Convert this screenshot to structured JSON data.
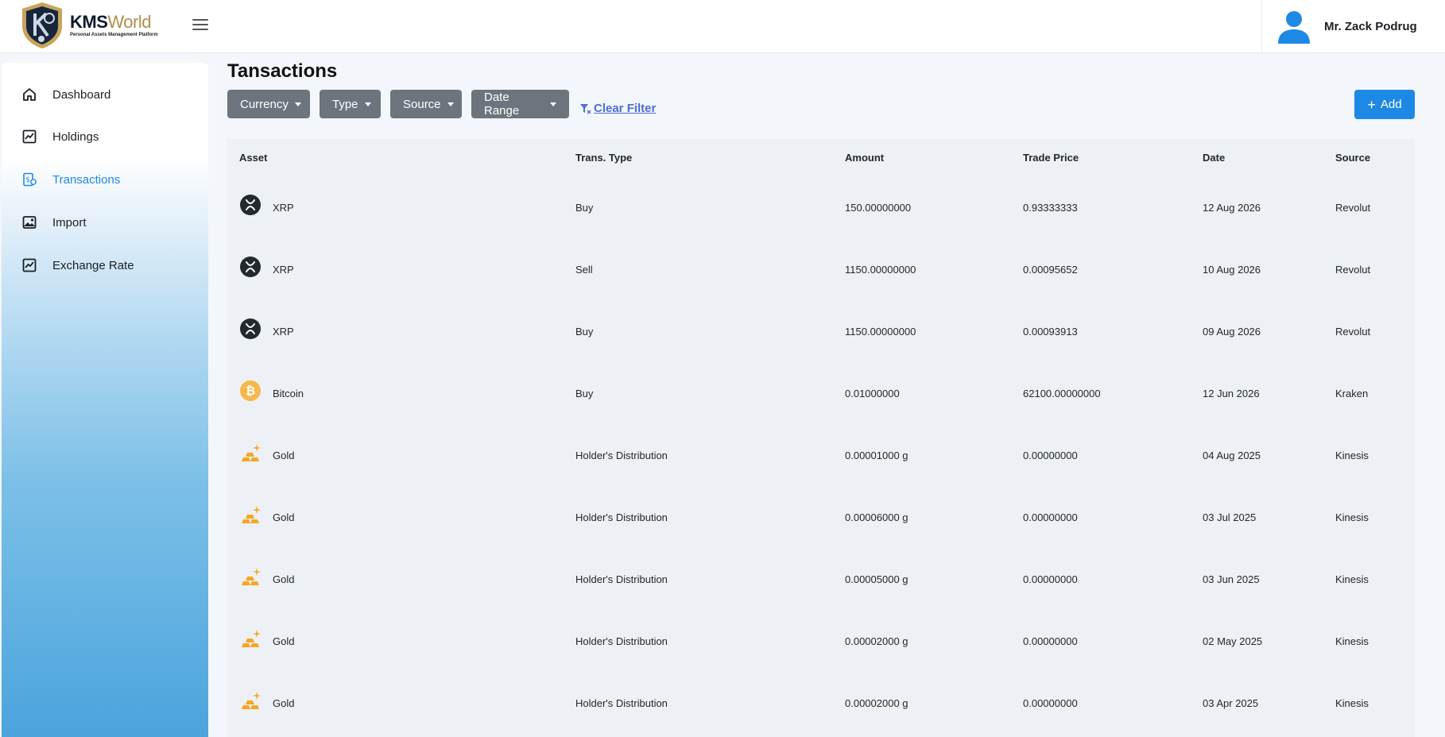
{
  "app": {
    "brand_main": "KMS",
    "brand_accent": "World",
    "brand_subtitle": "Personal Assets Management Platform",
    "accent_color": "#1e88e5"
  },
  "header": {
    "user_name": "Mr. Zack Podrug"
  },
  "sidebar": {
    "items": [
      {
        "label": "Dashboard",
        "icon": "home-icon"
      },
      {
        "label": "Holdings",
        "icon": "chart-line-icon"
      },
      {
        "label": "Transactions",
        "icon": "transactions-icon",
        "active": true
      },
      {
        "label": "Import",
        "icon": "image-import-icon"
      },
      {
        "label": "Exchange Rate",
        "icon": "chart-line-icon"
      }
    ]
  },
  "page": {
    "title": "Tansactions"
  },
  "filters": {
    "currency": "Currency",
    "type": "Type",
    "source": "Source",
    "date_range": "Date Range",
    "clear": "Clear Filter",
    "add": "Add"
  },
  "table": {
    "headers": [
      "Asset",
      "Trans. Type",
      "Amount",
      "Trade Price",
      "Date",
      "Source"
    ],
    "rows": [
      {
        "asset": "XRP",
        "icon": "xrp-icon",
        "type": "Buy",
        "amount": "150.00000000",
        "price": "0.93333333",
        "date": "12 Aug 2026",
        "source": "Revolut"
      },
      {
        "asset": "XRP",
        "icon": "xrp-icon",
        "type": "Sell",
        "amount": "1150.00000000",
        "price": "0.00095652",
        "date": "10 Aug 2026",
        "source": "Revolut"
      },
      {
        "asset": "XRP",
        "icon": "xrp-icon",
        "type": "Buy",
        "amount": "1150.00000000",
        "price": "0.00093913",
        "date": "09 Aug 2026",
        "source": "Revolut"
      },
      {
        "asset": "Bitcoin",
        "icon": "bitcoin-icon",
        "type": "Buy",
        "amount": "0.01000000",
        "price": "62100.00000000",
        "date": "12 Jun 2026",
        "source": "Kraken"
      },
      {
        "asset": "Gold",
        "icon": "gold-bars-icon",
        "type": "Holder's Distribution",
        "amount": "0.00001000 g",
        "price": "0.00000000",
        "date": "04 Aug 2025",
        "source": "Kinesis"
      },
      {
        "asset": "Gold",
        "icon": "gold-bars-icon",
        "type": "Holder's Distribution",
        "amount": "0.00006000 g",
        "price": "0.00000000",
        "date": "03 Jul 2025",
        "source": "Kinesis"
      },
      {
        "asset": "Gold",
        "icon": "gold-bars-icon",
        "type": "Holder's Distribution",
        "amount": "0.00005000 g",
        "price": "0.00000000",
        "date": "03 Jun 2025",
        "source": "Kinesis"
      },
      {
        "asset": "Gold",
        "icon": "gold-bars-icon",
        "type": "Holder's Distribution",
        "amount": "0.00002000 g",
        "price": "0.00000000",
        "date": "02 May 2025",
        "source": "Kinesis"
      },
      {
        "asset": "Gold",
        "icon": "gold-bars-icon",
        "type": "Holder's Distribution",
        "amount": "0.00002000 g",
        "price": "0.00000000",
        "date": "03 Apr 2025",
        "source": "Kinesis"
      }
    ]
  }
}
